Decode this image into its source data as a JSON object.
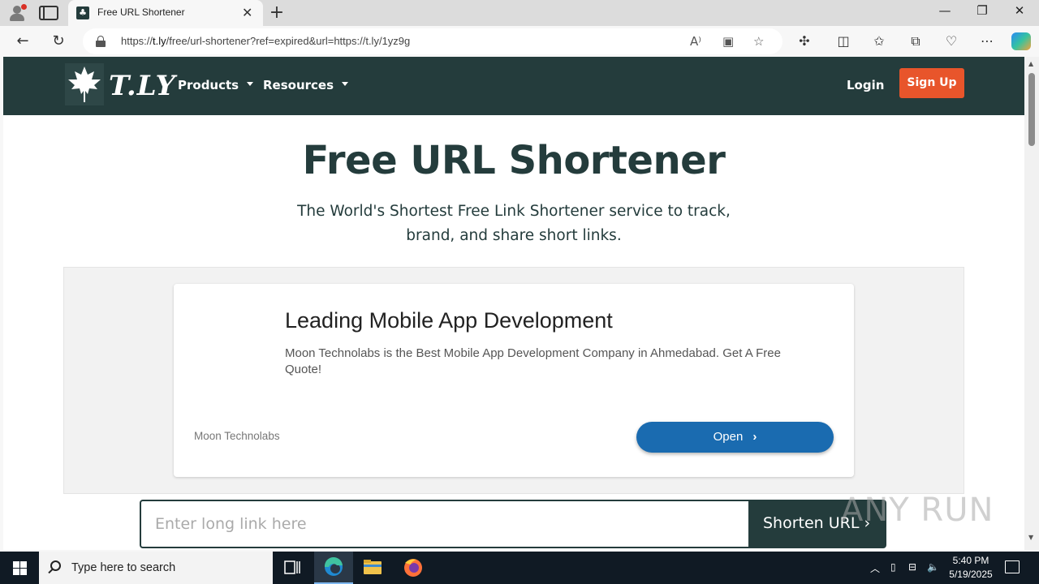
{
  "browser": {
    "tab_title": "Free URL Shortener",
    "tab_close_glyph": "✕",
    "new_tab_glyph": "+",
    "url_prefix": "https://",
    "url_host": "t.ly",
    "url_rest": "/free/url-shortener?ref=expired&url=https://t.ly/1yz9g",
    "window_controls": [
      "—",
      "❐",
      "✕"
    ],
    "icons": [
      "profile-icon",
      "tab-actions-icon",
      "back-icon",
      "refresh-icon",
      "lock-icon",
      "read-aloud-icon",
      "immersive-reader-icon",
      "favorite-star-icon",
      "extensions-icon",
      "split-screen-icon",
      "favorites-icon",
      "collections-icon",
      "browser-essentials-icon",
      "more-icon",
      "copilot-icon"
    ]
  },
  "site": {
    "logo_text": "T.LY",
    "nav": {
      "products": "Products",
      "resources": "Resources",
      "login": "Login",
      "signup": "Sign Up"
    },
    "hero": {
      "title": "Free URL Shortener",
      "subtitle": "The World's Shortest Free Link Shortener service to track, brand, and share short links."
    },
    "ad": {
      "title": "Leading Mobile App Development",
      "description": "Moon Technolabs is the Best Mobile App Development Company in Ahmedabad. Get A Free Quote!",
      "brand": "Moon Technolabs",
      "cta": "Open"
    },
    "shorten": {
      "placeholder": "Enter long link here",
      "button": "Shorten URL"
    }
  },
  "watermark": "ANY RUN",
  "taskbar": {
    "search_placeholder": "Type here to search",
    "time": "5:40 PM",
    "date": "5/19/2025",
    "apps": [
      "task-view-icon",
      "edge-icon",
      "file-explorer-icon",
      "firefox-icon"
    ]
  },
  "colors": {
    "brand_dark": "#243c3c",
    "signup_orange": "#e8552b",
    "ad_button_blue": "#1a6bb0"
  }
}
